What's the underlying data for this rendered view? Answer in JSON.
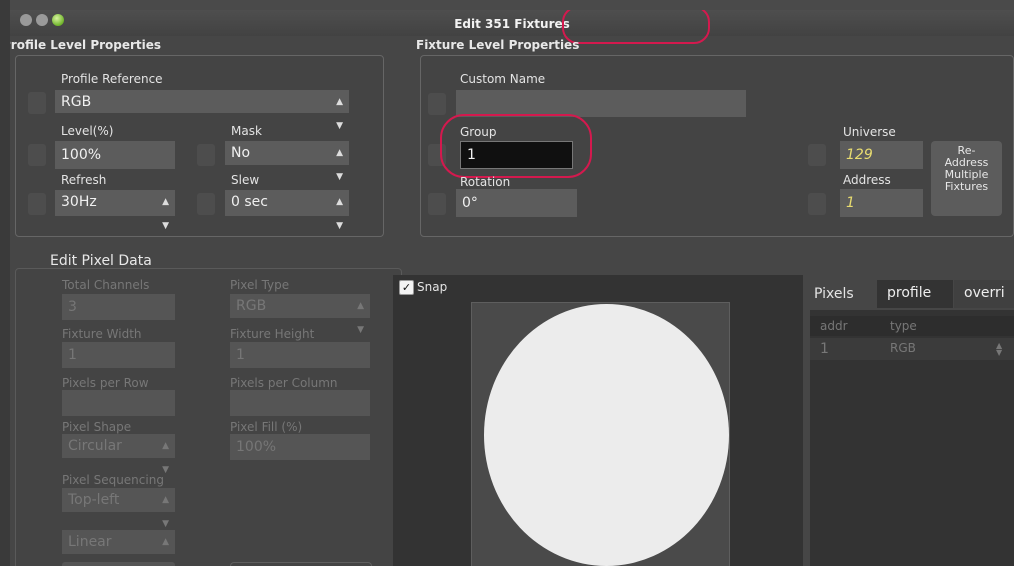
{
  "window": {
    "title": "Edit 351 Fixtures"
  },
  "profile": {
    "heading": "Profile Level Properties",
    "profile_reference_label": "Profile Reference",
    "profile_reference_value": "RGB",
    "level_label": "Level(%)",
    "level_value": "100%",
    "mask_label": "Mask",
    "mask_value": "No",
    "refresh_label": "Refresh",
    "refresh_value": "30Hz",
    "slew_label": "Slew",
    "slew_value": "0 sec"
  },
  "fixture": {
    "heading": "Fixture Level Properties",
    "custom_name_label": "Custom Name",
    "custom_name_value": "",
    "group_label": "Group",
    "group_value": "1",
    "rotation_label": "Rotation",
    "rotation_value": "0°",
    "universe_label": "Universe",
    "universe_value": "129",
    "address_label": "Address",
    "address_value": "1",
    "readdress_line1": "Re-",
    "readdress_line2": "Address",
    "readdress_line3": "Multiple",
    "readdress_line4": "Fixtures"
  },
  "pixel_data": {
    "heading": "Edit Pixel Data",
    "total_channels_label": "Total Channels",
    "total_channels_value": "3",
    "pixel_type_label": "Pixel Type",
    "pixel_type_value": "RGB",
    "fixture_width_label": "Fixture Width",
    "fixture_width_value": "1",
    "fixture_height_label": "Fixture Height",
    "fixture_height_value": "1",
    "pixels_per_row_label": "Pixels per Row",
    "pixels_per_row_value": "",
    "pixels_per_column_label": "Pixels per Column",
    "pixels_per_column_value": "",
    "pixel_shape_label": "Pixel Shape",
    "pixel_shape_value": "Circular",
    "pixel_fill_label": "Pixel Fill (%)",
    "pixel_fill_value": "100%",
    "pixel_sequencing_label": "Pixel Sequencing",
    "pixel_sequencing_value": "Top-left",
    "sequencing_mode_value": "Linear"
  },
  "canvas": {
    "snap_label": "Snap",
    "snap_checked": true
  },
  "pixels_panel": {
    "title": "Pixels",
    "tabs": [
      "profile",
      "overri"
    ],
    "columns": [
      "addr",
      "type"
    ],
    "rows": [
      {
        "addr": "1",
        "type": "RGB"
      }
    ]
  },
  "colors": {
    "highlight": "#d4194e",
    "italic_value": "#e8dc70"
  }
}
